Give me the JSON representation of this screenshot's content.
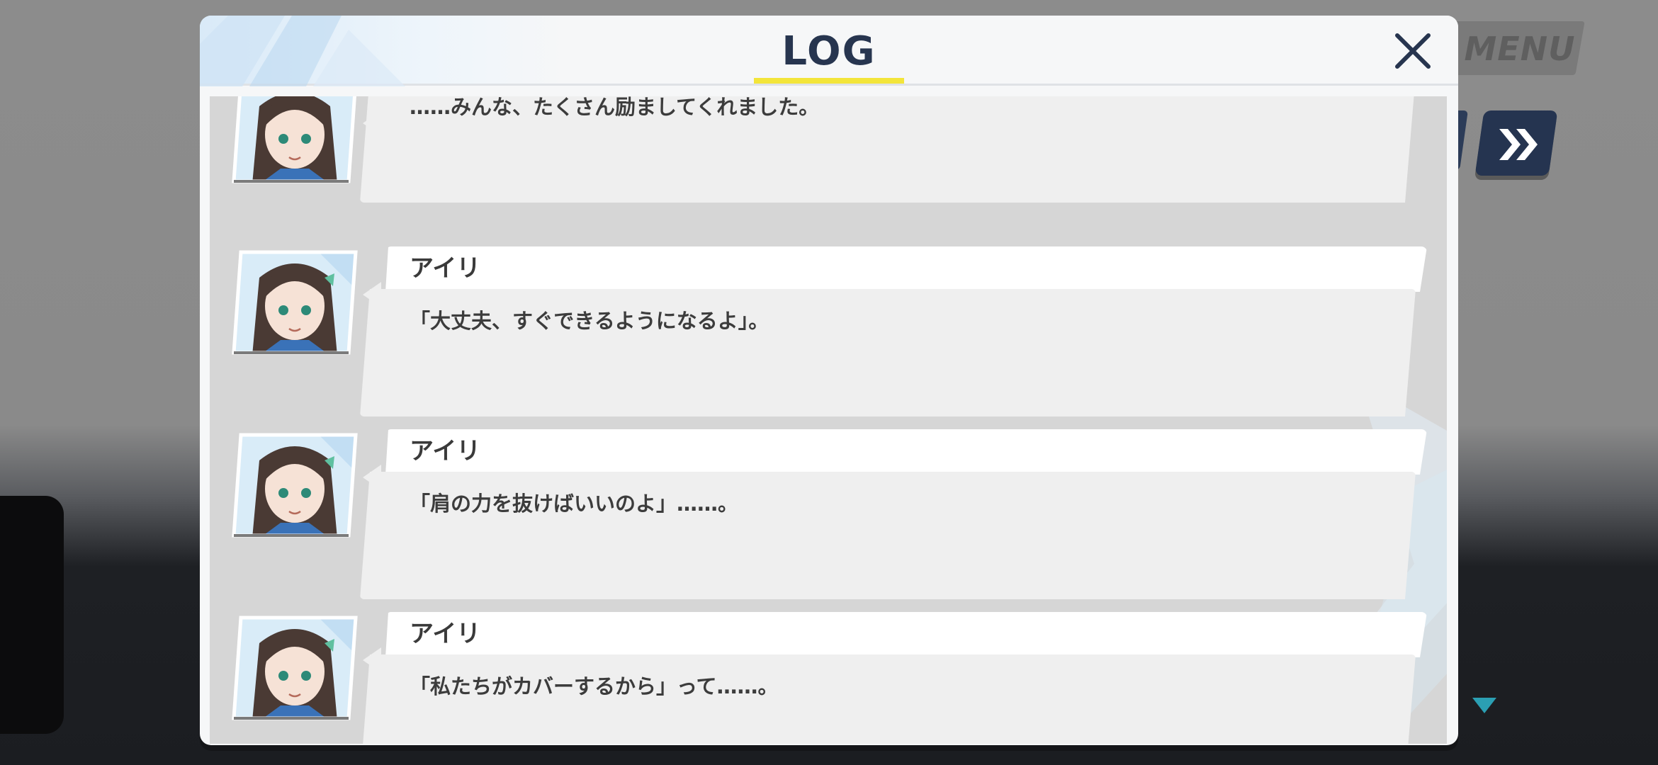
{
  "background": {
    "menu_label": "MENU",
    "skip_icon": "double-chevron-right-icon",
    "scroll_indicator": "down-triangle-icon"
  },
  "log": {
    "title": "LOG",
    "close_icon": "close-icon",
    "accent_color": "#f3e53a",
    "title_color": "#27354f",
    "entries": [
      {
        "speaker": "",
        "text": "……みんな、たくさん励ましてくれました。"
      },
      {
        "speaker": "アイリ",
        "text": "「大丈夫、すぐできるようになるよ」。"
      },
      {
        "speaker": "アイリ",
        "text": "「肩の力を抜けばいいのよ」……。"
      },
      {
        "speaker": "アイリ",
        "text": "「私たちがカバーするから」って……。"
      }
    ]
  }
}
